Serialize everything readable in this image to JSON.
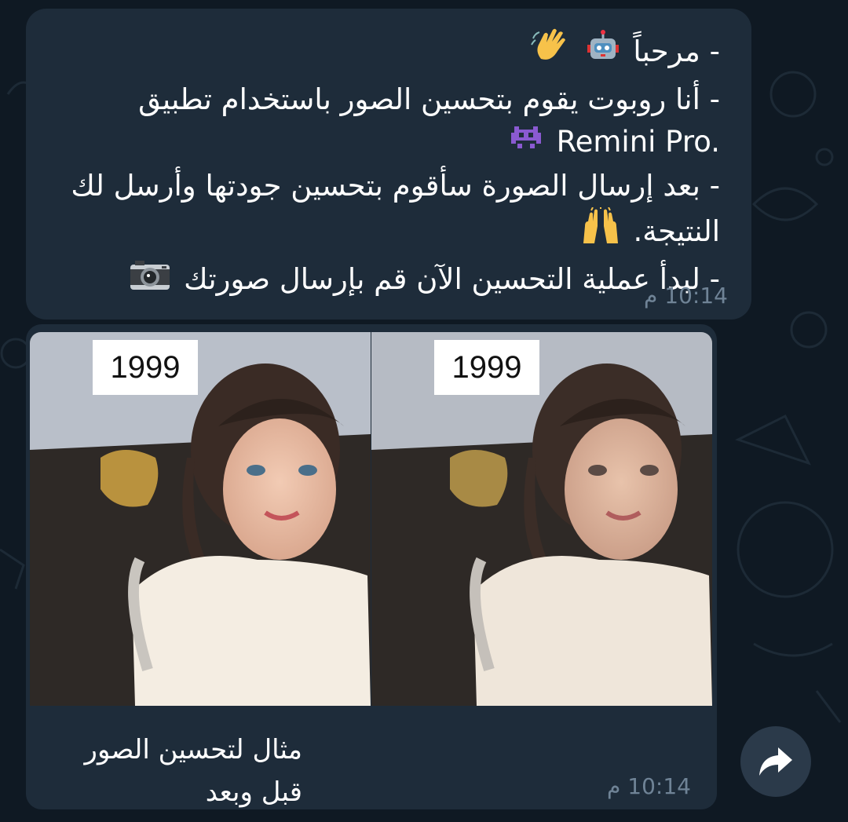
{
  "message1": {
    "lines": [
      "- مرحباً",
      "- أنا روبوت يقوم بتحسين الصور باستخدام تطبيق",
      "Remini Pro.",
      "- بعد إرسال الصورة سأقوم بتحسين جودتها وأرسل لك",
      "النتيجة.",
      "- لبدأ عملية التحسين الآن قم بإرسال صورتك"
    ],
    "time": "10:14 م"
  },
  "message2": {
    "photos": [
      {
        "label": "1999"
      },
      {
        "label": "1999"
      }
    ],
    "caption_lines": [
      "مثال لتحسين الصور",
      "قبل وبعد"
    ],
    "time": "10:14 م"
  },
  "icons": {
    "share": "share-arrow-icon"
  },
  "colors": {
    "background": "#0f1923",
    "bubble": "#1e2c3a",
    "text": "#ffffff",
    "time": "#6f8396"
  }
}
